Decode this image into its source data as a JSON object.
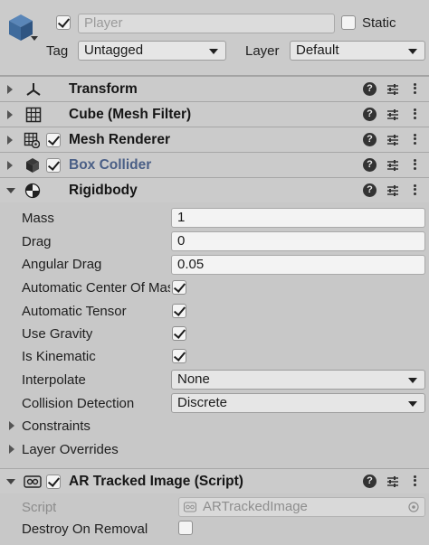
{
  "gameobject": {
    "icon": "cube-icon",
    "active": true,
    "name": "Player",
    "static_label": "Static",
    "static_checked": false,
    "tag_label": "Tag",
    "tag_value": "Untagged",
    "layer_label": "Layer",
    "layer_value": "Default"
  },
  "components": [
    {
      "title": "Transform",
      "icon": "transform-icon",
      "expanded": false
    },
    {
      "title": "Cube (Mesh Filter)",
      "icon": "grid-icon",
      "expanded": false
    },
    {
      "title": "Mesh Renderer",
      "icon": "mesh-renderer-icon",
      "expanded": false,
      "enabled": true
    },
    {
      "title": "Box Collider",
      "icon": "box-collider-icon",
      "expanded": false,
      "enabled": true
    },
    {
      "title": "Rigidbody",
      "icon": "rigidbody-icon",
      "expanded": true
    },
    {
      "title": "AR Tracked Image (Script)",
      "icon": "script-icon",
      "expanded": true,
      "enabled": true
    }
  ],
  "rigidbody": {
    "mass_label": "Mass",
    "mass": "1",
    "drag_label": "Drag",
    "drag": "0",
    "angular_drag_label": "Angular Drag",
    "angular_drag": "0.05",
    "auto_com_label": "Automatic Center Of Mass",
    "auto_com": true,
    "auto_tensor_label": "Automatic Tensor",
    "auto_tensor": true,
    "use_gravity_label": "Use Gravity",
    "use_gravity": true,
    "is_kinematic_label": "Is Kinematic",
    "is_kinematic": true,
    "interpolate_label": "Interpolate",
    "interpolate": "None",
    "collision_label": "Collision Detection",
    "collision": "Discrete",
    "constraints_label": "Constraints",
    "layer_overrides_label": "Layer Overrides"
  },
  "ar_tracked_image": {
    "script_label": "Script",
    "script_value": "ARTrackedImage",
    "destroy_label": "Destroy On Removal",
    "destroy_checked": false
  },
  "header_buttons": {
    "help": "?"
  }
}
